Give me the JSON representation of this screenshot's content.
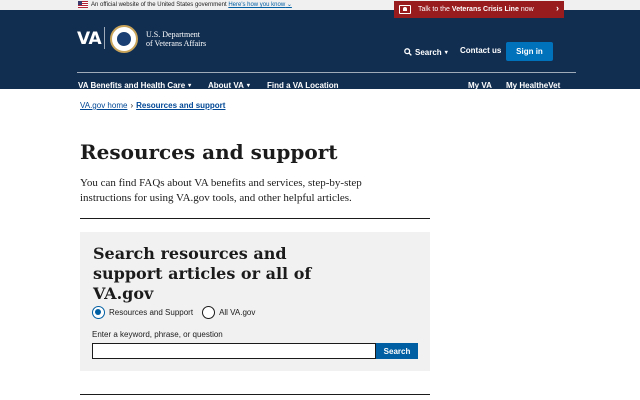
{
  "gov_banner": {
    "text": "An official website of the United States government",
    "link": "Here's how you know"
  },
  "crisis_line": {
    "prefix": "Talk to the",
    "bold": "Veterans Crisis Line",
    "suffix": "now",
    "chevron": "›"
  },
  "header": {
    "wordmark": "VA",
    "dept_line1": "U.S. Department",
    "dept_line2": "of Veterans Affairs",
    "search_label": "Search",
    "contact_label": "Contact us",
    "signin_label": "Sign in"
  },
  "nav": {
    "items": [
      {
        "label": "VA Benefits and Health Care",
        "has_menu": true
      },
      {
        "label": "About VA",
        "has_menu": true
      },
      {
        "label": "Find a VA Location",
        "has_menu": false
      },
      {
        "label": "My VA",
        "has_menu": false
      },
      {
        "label": "My HealtheVet",
        "has_menu": false
      }
    ]
  },
  "breadcrumb": {
    "home": "VA.gov home",
    "separator": "›",
    "current": "Resources and support"
  },
  "main": {
    "title": "Resources and support",
    "intro": "You can find FAQs about VA benefits and services, step-by-step instructions for using VA.gov tools, and other helpful articles."
  },
  "search_panel": {
    "title": "Search resources and support articles or all of VA.gov",
    "options": [
      {
        "label": "Resources and Support",
        "checked": true
      },
      {
        "label": "All VA.gov",
        "checked": false
      }
    ],
    "field_label": "Enter a keyword, phrase, or question",
    "input_value": "",
    "submit_label": "Search"
  },
  "colors": {
    "header_bg": "#112e51",
    "crisis_bg": "#981b1e",
    "primary_button": "#005ea2",
    "signin_button": "#0071bb",
    "panel_bg": "#f1f1f1"
  },
  "icons": [
    "us-flag-icon",
    "va-seal-icon",
    "search-icon",
    "crisis-line-icon",
    "chevron-down-icon",
    "chevron-right-icon"
  ]
}
